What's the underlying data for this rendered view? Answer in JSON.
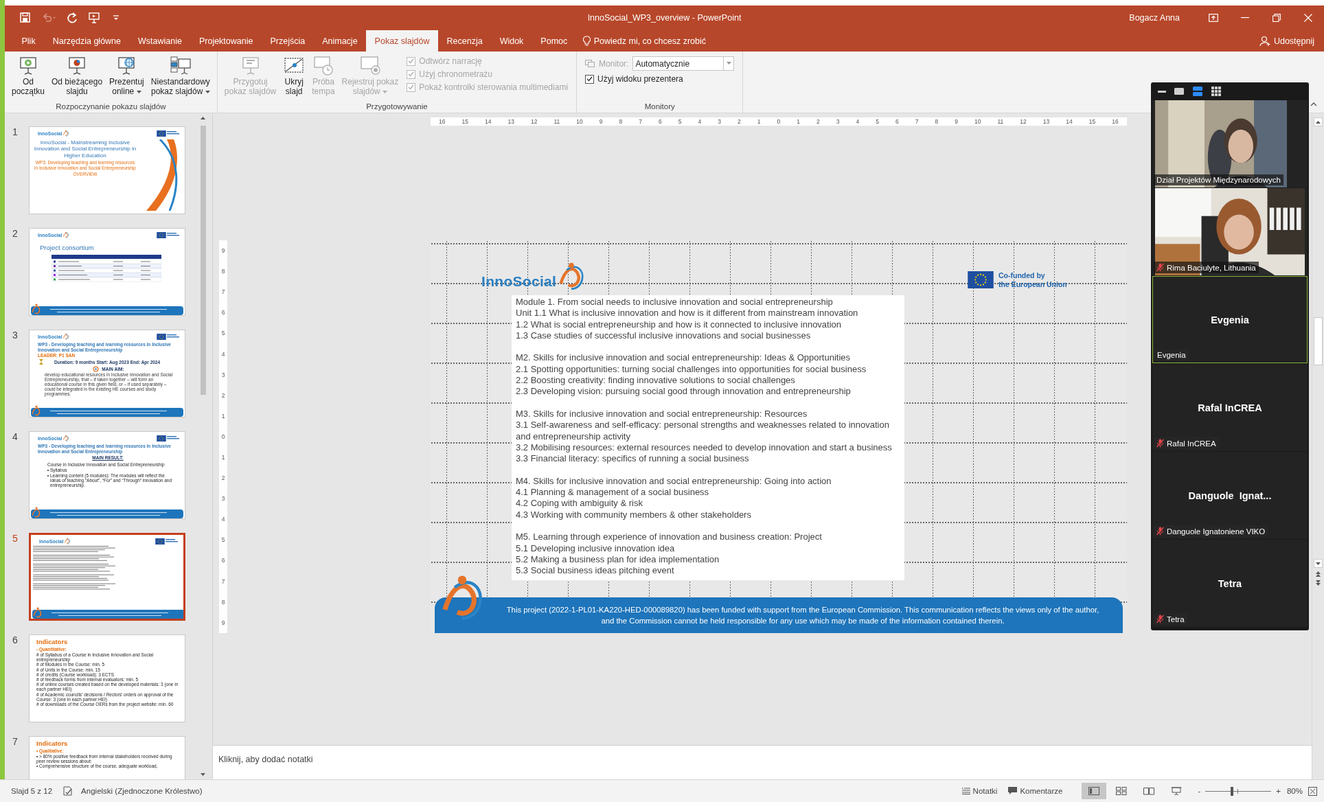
{
  "window": {
    "title": "InnoSocial_WP3_overview  -  PowerPoint",
    "user": "Bogacz Anna"
  },
  "quick_access": [
    {
      "kind": "save",
      "disabled": false
    },
    {
      "kind": "undo",
      "disabled": true
    },
    {
      "kind": "redo",
      "disabled": false
    },
    {
      "kind": "present",
      "disabled": false
    },
    {
      "kind": "customize",
      "disabled": false
    }
  ],
  "tabs": [
    {
      "label": "Plik",
      "selected": false
    },
    {
      "label": "Narzędzia główne",
      "selected": false
    },
    {
      "label": "Wstawianie",
      "selected": false
    },
    {
      "label": "Projektowanie",
      "selected": false
    },
    {
      "label": "Przejścia",
      "selected": false
    },
    {
      "label": "Animacje",
      "selected": false
    },
    {
      "label": "Pokaz slajdów",
      "selected": true
    },
    {
      "label": "Recenzja",
      "selected": false
    },
    {
      "label": "Widok",
      "selected": false
    },
    {
      "label": "Pomoc",
      "selected": false
    }
  ],
  "tell_me": "Powiedz mi, co chcesz zrobić",
  "share": "Udostępnij",
  "ribbon": {
    "groups": [
      {
        "label": "Rozpoczynanie pokazu slajdów",
        "items": [
          {
            "kind": "large_button",
            "label": "Od\npoczątku",
            "disabled": false,
            "dropdown": false
          },
          {
            "kind": "large_button",
            "label": "Od bieżącego\nslajdu",
            "disabled": false,
            "dropdown": false
          },
          {
            "kind": "large_button",
            "label": "Prezentuj\nonline",
            "disabled": false,
            "dropdown": true
          },
          {
            "kind": "large_button",
            "label": "Niestandardowy\npokaz slajdów",
            "disabled": false,
            "dropdown": true
          }
        ]
      },
      {
        "label": "Przygotowywanie",
        "items": [
          {
            "kind": "large_button",
            "label": "Przygotuj\npokaz slajdów",
            "disabled": true,
            "dropdown": false
          },
          {
            "kind": "large_button",
            "label": "Ukryj\nslajd",
            "disabled": false,
            "dropdown": false
          },
          {
            "kind": "large_button",
            "label": "Próba\ntempa",
            "disabled": true,
            "dropdown": false
          },
          {
            "kind": "large_button",
            "label": "Rejestruj pokaz\nslajdów",
            "disabled": true,
            "dropdown": true
          },
          {
            "kind": "checkbox",
            "label": "Odtwórz narrację",
            "checked": true,
            "disabled": true
          },
          {
            "kind": "checkbox",
            "label": "Użyj chronometrażu",
            "checked": true,
            "disabled": true
          },
          {
            "kind": "checkbox",
            "label": "Pokaż kontrolki sterowania multimediami",
            "checked": true,
            "disabled": true
          }
        ]
      },
      {
        "label": "Monitory",
        "items": [
          {
            "kind": "dropdown",
            "label": "Monitor:",
            "value": "Automatycznie",
            "disabled": true
          },
          {
            "kind": "checkbox",
            "label": "Użyj widoku prezentera",
            "checked": true,
            "disabled": false
          }
        ]
      }
    ]
  },
  "thumbnails": [
    {
      "number": "1",
      "selected": false,
      "kind": "title",
      "logo": "InnoSocial",
      "title": "InnoSocial - Mainstreaming Inclusive Innovation and Social Entrepreneurship in Higher Education",
      "subtitle": "WP3: Developing teaching and learning resources in Inclusive Innovation and Social Entrepreneurship",
      "tag": "OVERVIEW"
    },
    {
      "number": "2",
      "selected": false,
      "kind": "consortium",
      "logo": "InnoSocial",
      "title": "Project consortium"
    },
    {
      "number": "3",
      "selected": false,
      "kind": "wp3",
      "logo": "InnoSocial",
      "title": "WP3 - Developing teaching and learning resources in Inclusive Innovation and Social Entrepreneurship",
      "leader": "LEADER: P1 SAN",
      "duration": "Duration: 9 months   Start: Aug 2023 End: Apr 2024",
      "aim_heading": "MAIN AIM:",
      "aim": "develop educational resources in Inclusive Innovation and Social Entrepreneurship, that – if taken together – will form an educational course in this given field, or – if used separately – could be integrated in the existing HE courses and study programmes."
    },
    {
      "number": "4",
      "selected": false,
      "kind": "result",
      "logo": "InnoSocial",
      "title": "WP3 - Developing teaching and learning resources in Inclusive Innovation and Social Entrepreneurship",
      "result_heading": "MAIN RESULT:",
      "intro": "Course in Inclusive Innovation and Social Entrepreneurship",
      "bullets": [
        "Syllabus",
        "Learning content (5 modules): The modules will reflect the ideas of teaching “About”, “For” and “Through” innovation and entrepreneurship."
      ]
    },
    {
      "number": "5",
      "selected": true,
      "kind": "content",
      "logo": "InnoSocial"
    },
    {
      "number": "6",
      "selected": false,
      "kind": "indicators",
      "heading": "Indicators",
      "subheading": "- Quantitative:",
      "items": [
        "# of Syllabus of a Course in Inclusive innovation and Social entrepreneurship",
        "# of Modules in the Course: min. 5",
        "# of Units in the Course: min. 15",
        "# of credits (Course workload): 3 ECTS",
        "# of feedback forms from internal evaluators: min. 5",
        "# of online courses created based on the developed materials: 3 (one in each partner HEI)",
        "# of Academic councils' decisions / Rectors' orders on approval of the Course: 3 (one in each partner HEI)",
        "# of downloads of the Course OERs from the project website: min. 60"
      ]
    },
    {
      "number": "7",
      "selected": false,
      "kind": "indicators",
      "heading": "Indicators",
      "subheading": "• Qualitative:",
      "items": [
        "• > 80% positive feedback from internal stakeholders received during peer review sessions about:",
        "• Comprehensive structure of the course, adequate workload,"
      ]
    }
  ],
  "rulers": {
    "horizontal": [
      "16",
      "15",
      "14",
      "13",
      "12",
      "11",
      "10",
      "9",
      "8",
      "7",
      "6",
      "5",
      "4",
      "3",
      "2",
      "1",
      "0",
      "1",
      "2",
      "3",
      "4",
      "5",
      "6",
      "7",
      "8",
      "9",
      "10",
      "11",
      "12",
      "13",
      "14",
      "15",
      "16"
    ],
    "vertical": [
      "9",
      "8",
      "7",
      "6",
      "5",
      "4",
      "3",
      "2",
      "1",
      "0",
      "1",
      "2",
      "3",
      "4",
      "5",
      "6",
      "7",
      "8",
      "9"
    ]
  },
  "slide": {
    "logo": "InnoSocial",
    "funding": "Co-funded by\nthe European Union",
    "content": [
      [
        "Module 1. From social needs to inclusive innovation and social entrepreneurship",
        "Unit 1.1 What is inclusive innovation and how is it different from mainstream innovation",
        "1.2 What is social entrepreneurship and how is it connected to inclusive innovation",
        "1.3 Case studies of successful inclusive innovations and social businesses"
      ],
      [
        "M2. Skills for inclusive innovation and social entrepreneurship: Ideas & Opportunities",
        "2.1 Spotting opportunities: turning social challenges into opportunities for social business",
        "2.2 Boosting creativity: finding innovative solutions to social challenges",
        "2.3 Developing vision: pursuing social good through innovation and entrepreneurship"
      ],
      [
        "M3. Skills for inclusive innovation and social entrepreneurship: Resources",
        "3.1 Self-awareness and self-efficacy: personal strengths and weaknesses related to innovation and entrepreneurship activity",
        "3.2 Mobilising resources: external resources needed to develop innovation and start a business",
        "3.3 Financial literacy: specifics of running a social business"
      ],
      [
        "M4. Skills for inclusive innovation and social entrepreneurship: Going into action",
        "4.1 Planning & management of a social business",
        "4.2 Coping with ambiguity & risk",
        "4.3 Working with community members & other stakeholders"
      ],
      [
        "M5. Learning through experience of innovation and business creation: Project",
        "5.1 Developing inclusive innovation idea",
        "5.2 Making a business plan for idea implementation",
        "5.3 Social business ideas pitching event"
      ]
    ],
    "footer": "This project (2022-1-PL01-KA220-HED-000089820) has been funded with support from the European Commission. This communication reflects the views only of the author, and the Commission cannot be held responsible for any use which may be made of the information contained therein."
  },
  "notes_placeholder": "Kliknij, aby dodać notatki",
  "meeting": {
    "view_buttons": [
      {
        "selected": false
      },
      {
        "selected": false
      },
      {
        "selected": true
      },
      {
        "selected": false
      }
    ],
    "participants": [
      {
        "kind": "video",
        "name": "Dział Projektów Międzynarodowych",
        "muted": false,
        "speaking": false
      },
      {
        "kind": "video",
        "name": "Rima Baciulyte, Lithuania",
        "muted": true,
        "speaking": false
      },
      {
        "kind": "name",
        "display": "Evgenia",
        "name": "Evgenia",
        "muted": false,
        "speaking": true
      },
      {
        "kind": "name",
        "display": "Rafal InCREA",
        "name": "Rafal InCREA",
        "muted": true,
        "speaking": false
      },
      {
        "kind": "name",
        "display": "Danguole  Ignat...",
        "name": "Danguole Ignatoniene VIKO",
        "muted": true,
        "speaking": false
      },
      {
        "kind": "name",
        "display": "Tetra",
        "name": "Tetra",
        "muted": true,
        "speaking": false
      }
    ]
  },
  "status": {
    "slide_indicator": "Slajd 5 z 12",
    "language": "Angielski (Zjednoczone Królestwo)",
    "notes": "Notatki",
    "comments": "Komentarze",
    "views": [
      {
        "selected": true
      },
      {
        "selected": false
      },
      {
        "selected": false
      },
      {
        "selected": false
      }
    ],
    "zoom": {
      "minus": "-",
      "plus": "+",
      "level": 0.4,
      "reading": "80%"
    }
  }
}
